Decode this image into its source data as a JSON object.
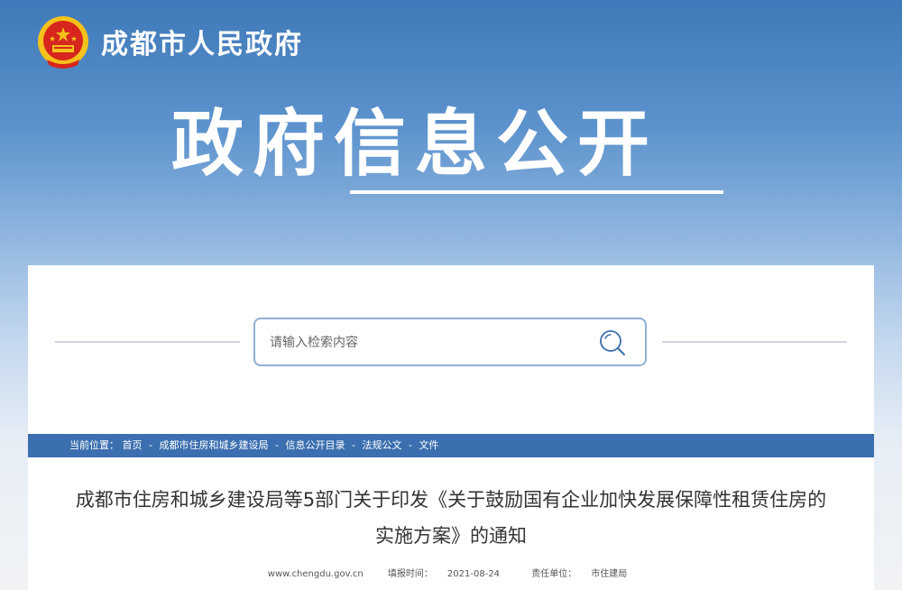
{
  "header": {
    "site_title": "成都市人民政府",
    "hero_title": "政府信息公开"
  },
  "search": {
    "placeholder": "请输入检索内容"
  },
  "breadcrumb": {
    "prefix": "当前位置：",
    "items": [
      "首页",
      "成都市住房和城乡建设局",
      "信息公开目录",
      "法规公文",
      "文件"
    ],
    "separator": "-"
  },
  "article": {
    "title_line1": "成都市住房和城乡建设局等5部门关于印发《关于鼓励国有企业加快发展保障性租赁住房的",
    "title_line2": "实施方案》的通知",
    "source_site": "www.chengdu.gov.cn",
    "date_label": "填报时间：",
    "date": "2021-08-24",
    "unit_label": "责任单位：",
    "unit": "市住建局"
  },
  "icons": {
    "emblem": "national-emblem-icon",
    "search": "search-icon"
  },
  "colors": {
    "banner_top": "#3f79b9",
    "breadcrumb_bar": "#3b6faf",
    "search_border": "#8fb0d6",
    "emblem_red": "#d7261e",
    "emblem_gold": "#f5c21b"
  }
}
